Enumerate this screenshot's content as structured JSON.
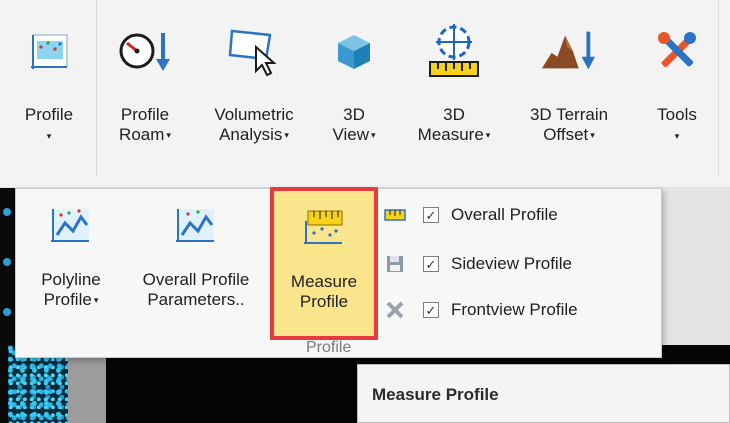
{
  "ribbon": {
    "buttons": [
      {
        "label_1": "Profile",
        "label_2": "",
        "icon": "profile-chart-icon",
        "dropdown": "▾"
      },
      {
        "label_1": "Profile",
        "label_2": "Roam",
        "icon": "gauge-roam-icon",
        "dropdown": "▾"
      },
      {
        "label_1": "Volumetric",
        "label_2": "Analysis",
        "icon": "volume-cursor-icon",
        "dropdown": "▾"
      },
      {
        "label_1": "3D",
        "label_2": "View",
        "icon": "cube-icon",
        "dropdown": "▾"
      },
      {
        "label_1": "3D",
        "label_2": "Measure",
        "icon": "crosshair-ruler-icon",
        "dropdown": "▾"
      },
      {
        "label_1": "3D Terrain",
        "label_2": "Offset",
        "icon": "terrain-arrow-icon",
        "dropdown": "▾"
      },
      {
        "label_1": "Tools",
        "label_2": "",
        "icon": "tools-icon",
        "dropdown": "▾"
      }
    ]
  },
  "panel": {
    "buttons": [
      {
        "label_1": "Polyline",
        "label_2": "Profile",
        "icon": "polyline-profile-icon",
        "dropdown": "▾"
      },
      {
        "label_1": "Overall Profile",
        "label_2": "Parameters..",
        "icon": "overall-profile-icon"
      },
      {
        "label_1": "Measure",
        "label_2": "Profile",
        "icon": "measure-profile-icon"
      }
    ],
    "checks": [
      {
        "label": "Overall Profile",
        "checked": true,
        "icon": "ruler-bar-icon"
      },
      {
        "label": "Sideview Profile",
        "checked": true,
        "icon": "save-icon"
      },
      {
        "label": "Frontview Profile",
        "checked": true,
        "icon": "close-x-icon"
      }
    ],
    "group_label": "Profile",
    "check_mark": "✓"
  },
  "tooltip": {
    "title": "Measure Profile"
  },
  "colors": {
    "highlight": "#fbe58c",
    "highlight_border": "#e53b3b",
    "ribbon_bg": "#f3f3f3",
    "panel_bg": "#f7f7f7"
  }
}
